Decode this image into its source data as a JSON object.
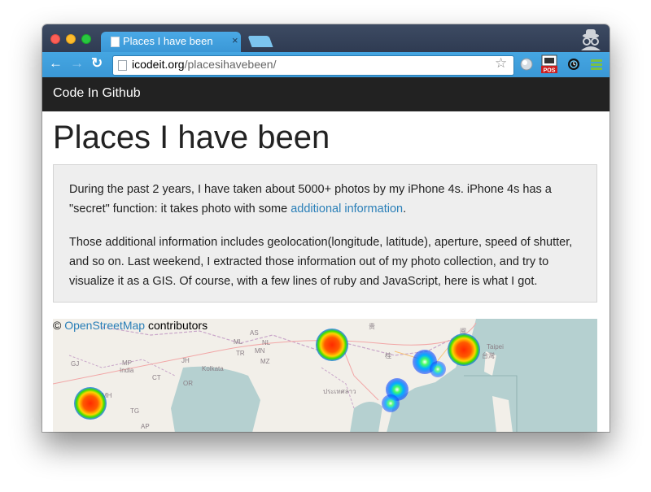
{
  "browser": {
    "tab_title": "Places I have been",
    "tab_close": "×",
    "url_host": "icodeit.org",
    "url_path": "/placesihavebeen/",
    "back": "←",
    "forward": "→",
    "reload": "↻",
    "star": "☆",
    "ext_pos_label": "POS"
  },
  "navbar": {
    "brand": "Code In Github"
  },
  "page": {
    "title": "Places I have been",
    "para1_before": "During the past 2 years, I have taken about 5000+ photos by my iPhone 4s. iPhone 4s has a \"secret\" function: it takes photo with some ",
    "para1_link": "additional information",
    "para1_after": ".",
    "para2": "Those additional information includes geolocation(longitude, latitude), aperture, speed of shutter, and so on. Last weekend, I extracted those information out of my photo collection, and try to visualize it as a GIS. Of course, with a few lines of ruby and JavaScript, here is what I got."
  },
  "map": {
    "attribution_prefix": "© ",
    "attribution_link": "OpenStreetMap",
    "attribution_suffix": " contributors",
    "labels": [
      "AS",
      "NL",
      "MP",
      "India",
      "JH",
      "Kolkata",
      "ML",
      "MN",
      "TR",
      "MZ",
      "CT",
      "OR",
      "GJ",
      "MH",
      "TG",
      "AP",
      "桂",
      "贵",
      "ประเทศลาว",
      "台灣",
      "Taipei",
      "闽"
    ]
  },
  "colors": {
    "navbar_bg": "#222222",
    "link": "#2a7fb8",
    "jumbotron_bg": "#eeeeee",
    "toolbar": "#3a98d6"
  }
}
